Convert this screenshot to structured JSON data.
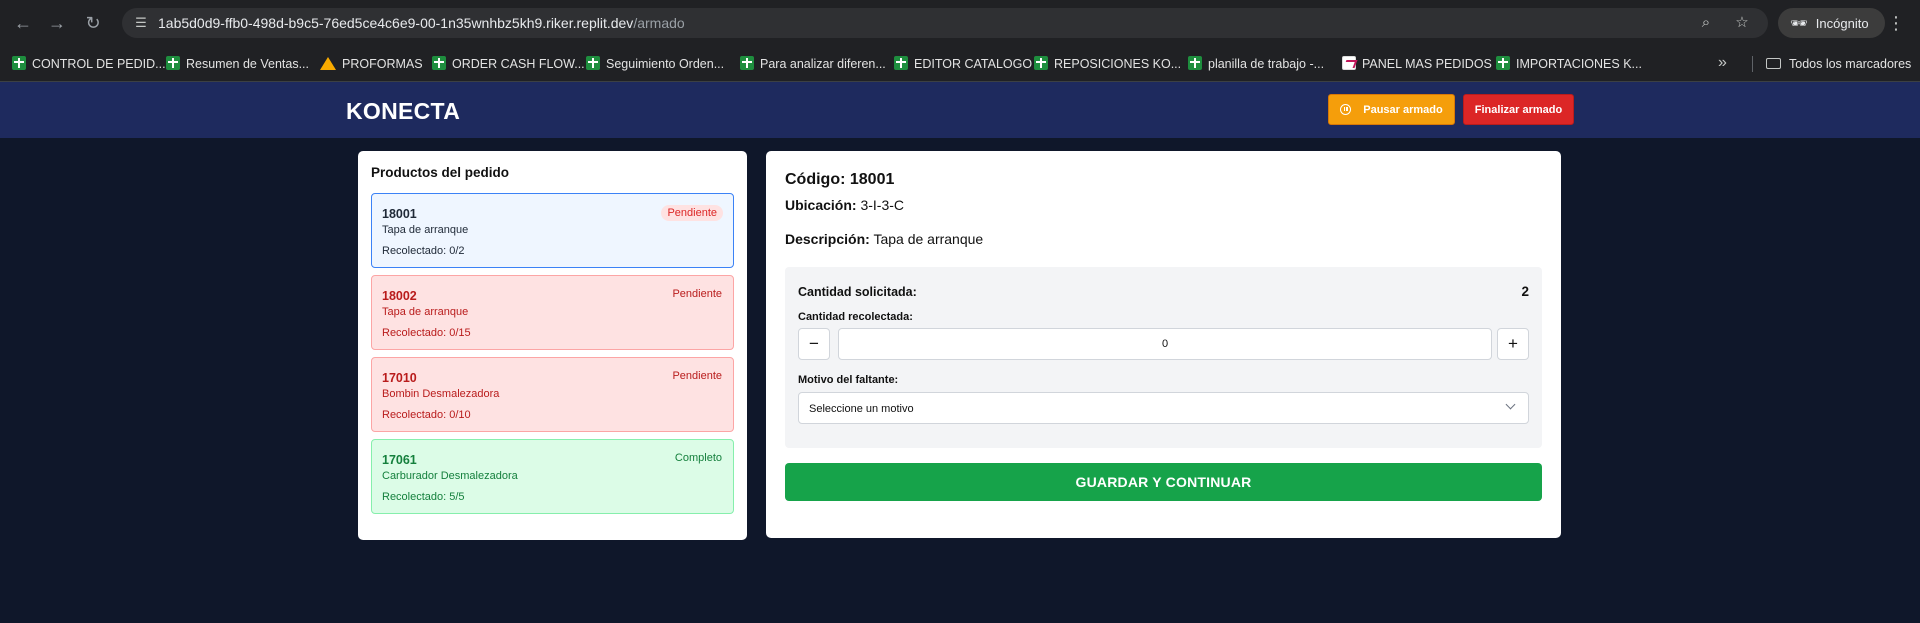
{
  "browser": {
    "url_host": "1ab5d0d9-ffb0-498d-b9c5-76ed5ce4c6e9-00-1n35wnhbz5kh9.riker.replit.dev",
    "url_path": "/armado",
    "incognito_label": "Incógnito",
    "nav_icons": [
      "back-arrow-icon",
      "forward-arrow-icon",
      "reload-icon"
    ],
    "bookmarks": [
      {
        "label": "CONTROL DE PEDID...",
        "icon": "sheets-icon"
      },
      {
        "label": "Resumen de Ventas...",
        "icon": "sheets-icon"
      },
      {
        "label": "PROFORMAS",
        "icon": "drive-icon"
      },
      {
        "label": "ORDER CASH FLOW...",
        "icon": "sheets-icon"
      },
      {
        "label": "Seguimiento Orden...",
        "icon": "sheets-icon"
      },
      {
        "label": "Para analizar diferen...",
        "icon": "sheets-icon"
      },
      {
        "label": "EDITOR CATALOGO",
        "icon": "sheets-icon"
      },
      {
        "label": "REPOSICIONES KO...",
        "icon": "sheets-icon"
      },
      {
        "label": "planilla de trabajo -...",
        "icon": "sheets-icon"
      },
      {
        "label": "PANEL MAS PEDIDOS",
        "icon": "panel-icon"
      },
      {
        "label": "IMPORTACIONES K...",
        "icon": "sheets-icon"
      }
    ],
    "all_bookmarks_label": "Todos los marcadores"
  },
  "header": {
    "brand": "KONECTA",
    "pause_label": "Pausar armado",
    "finish_label": "Finalizar armado",
    "colors": {
      "bar": "#1e2a5e",
      "pause": "#f59e0b",
      "finish": "#dc2626"
    }
  },
  "products": {
    "title": "Productos del pedido",
    "items": [
      {
        "code": "18001",
        "description": "Tapa de arranque",
        "collected": "Recolectado: 0/2",
        "status": "Pendiente",
        "state": "active"
      },
      {
        "code": "18002",
        "description": "Tapa de arranque",
        "collected": "Recolectado: 0/15",
        "status": "Pendiente",
        "state": "pending"
      },
      {
        "code": "17010",
        "description": "Bombin Desmalezadora",
        "collected": "Recolectado: 0/10",
        "status": "Pendiente",
        "state": "pending"
      },
      {
        "code": "17061",
        "description": "Carburador Desmalezadora",
        "collected": "Recolectado: 5/5",
        "status": "Completo",
        "state": "complete"
      }
    ]
  },
  "detail": {
    "code_label": "Código:",
    "code": "18001",
    "location_label": "Ubicación:",
    "location": "3-I-3-C",
    "description_label": "Descripción:",
    "description": "Tapa de arranque",
    "requested_label": "Cantidad solicitada:",
    "requested": "2",
    "collected_label": "Cantidad recolectada:",
    "collected_value": "0",
    "minus": "−",
    "plus": "+",
    "reason_label": "Motivo del faltante:",
    "reason_placeholder": "Seleccione un motivo",
    "save_label": "GUARDAR Y CONTINUAR",
    "save_color": "#16a34a"
  }
}
